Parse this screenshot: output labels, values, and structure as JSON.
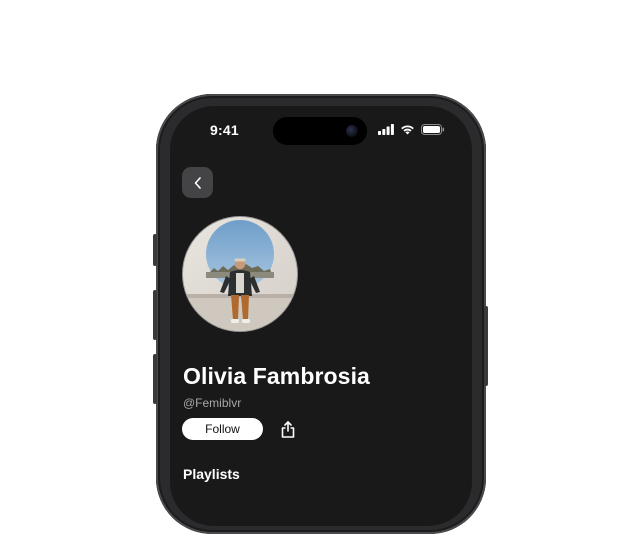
{
  "status_bar": {
    "time": "9:41",
    "icons": [
      "cellular-signal-icon",
      "wifi-icon",
      "battery-icon"
    ]
  },
  "profile": {
    "name": "Olivia Fambrosia",
    "handle": "@Femiblvr",
    "follow_label": "Follow",
    "avatar": "profile-photo"
  },
  "navigation": {
    "back_icon": "chevron-left-icon",
    "share_icon": "share-icon"
  },
  "sections": {
    "playlists_title": "Playlists"
  },
  "colors": {
    "screen_background": "#191919",
    "primary_text": "#ffffff",
    "secondary_text": "#a8a8a8",
    "button_background": "#ffffff",
    "back_button_background": "#444446"
  }
}
